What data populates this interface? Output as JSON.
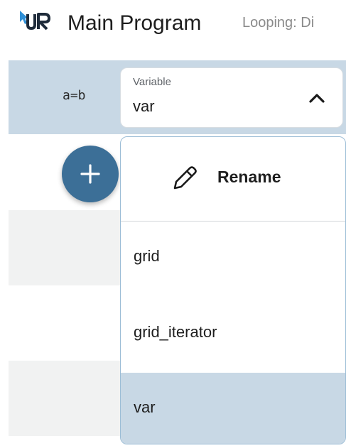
{
  "header": {
    "title": "Main Program",
    "looping_text": "Looping: Di"
  },
  "row": {
    "assign_symbol": "a=b"
  },
  "variable_select": {
    "label": "Variable",
    "value": "var"
  },
  "dropdown": {
    "rename_label": "Rename",
    "options": [
      {
        "label": "grid",
        "selected": false
      },
      {
        "label": "grid_iterator",
        "selected": false
      },
      {
        "label": "var",
        "selected": true
      }
    ]
  },
  "colors": {
    "accent": "#3c6f97",
    "selected_row": "#c8d8e5",
    "alt_row": "#f1f2f2",
    "dropdown_border": "#9cbdd6"
  },
  "icons": {
    "logo": "ur-logo",
    "chevron": "chevron-up-icon",
    "add": "plus-icon",
    "rename": "pencil-icon"
  }
}
